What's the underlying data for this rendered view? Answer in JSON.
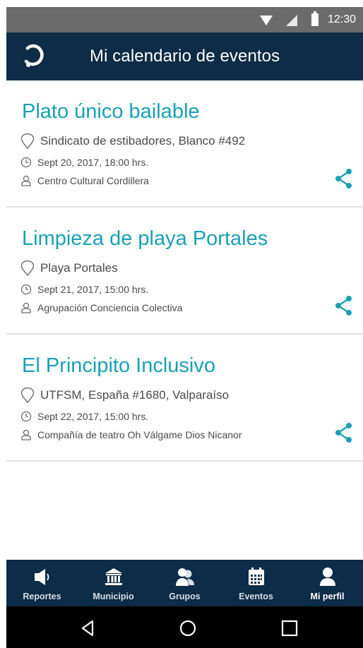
{
  "status_bar": {
    "time": "12:30",
    "icons": [
      "wifi-icon",
      "signal-icon",
      "battery-icon"
    ]
  },
  "app_bar": {
    "logo_icon": "app-logo-icon",
    "title": "Mi calendario de eventos"
  },
  "events": [
    {
      "title": "Plato único bailable",
      "location": "Sindicato de estibadores, Blanco #492",
      "date": "Sept 20, 2017, 18:00 hrs.",
      "organizer": "Centro Cultural Cordillera"
    },
    {
      "title": "Limpieza de playa Portales",
      "location": "Playa Portales",
      "date": "Sept 21, 2017, 15:00 hrs.",
      "organizer": "Agrupación Conciencia Colectiva"
    },
    {
      "title": "El Principito Inclusivo",
      "location": "UTFSM, España #1680, Valparaíso",
      "date": "Sept 22, 2017, 15:00 hrs.",
      "organizer": "Compañía de teatro Oh Válgame Dios Nicanor"
    }
  ],
  "bottom_nav": {
    "items": [
      {
        "label": "Reportes",
        "icon": "megaphone-icon"
      },
      {
        "label": "Municipio",
        "icon": "bank-icon"
      },
      {
        "label": "Grupos",
        "icon": "group-icon"
      },
      {
        "label": "Eventos",
        "icon": "calendar-icon"
      },
      {
        "label": "Mi perfil",
        "icon": "profile-icon"
      }
    ],
    "active": "Mi perfil"
  },
  "colors": {
    "primary_dark": "#0c2c47",
    "accent": "#1aa0b6",
    "status_bar": "#6b6b6b",
    "text": "#4a4a4a"
  }
}
